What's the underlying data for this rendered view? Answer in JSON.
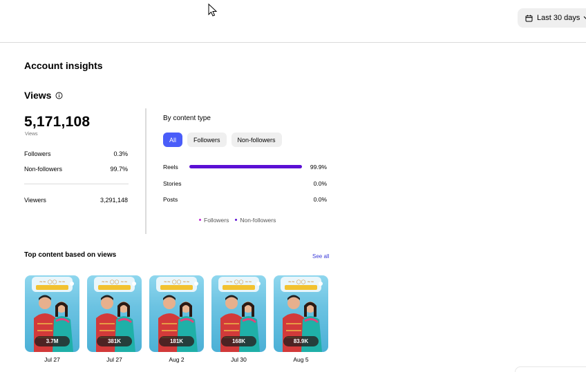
{
  "header": {
    "date_range_label": "Last 30 days",
    "calendar_icon": "calendar-icon",
    "chevron_icon": "chevron-down-icon"
  },
  "page_title": "Account insights",
  "views": {
    "title": "Views",
    "info_icon": "info-icon",
    "total": "5,171,108",
    "total_label": "Views",
    "followers_label": "Followers",
    "followers_pct": "0.3%",
    "nonfollowers_label": "Non-followers",
    "nonfollowers_pct": "99.7%",
    "viewers_label": "Viewers",
    "viewers_value": "3,291,148"
  },
  "content_type": {
    "title": "By content type",
    "tabs": [
      {
        "label": "All",
        "active": true
      },
      {
        "label": "Followers",
        "active": false
      },
      {
        "label": "Non-followers",
        "active": false
      }
    ],
    "rows": [
      {
        "label": "Reels",
        "pct": "99.9%",
        "value": 0.999
      },
      {
        "label": "Stories",
        "pct": "0.0%",
        "value": 0.0
      },
      {
        "label": "Posts",
        "pct": "0.0%",
        "value": 0.0
      }
    ],
    "legend": [
      {
        "label": "Followers",
        "color": "#c026d3"
      },
      {
        "label": "Non-followers",
        "color": "#5b0fd4"
      }
    ]
  },
  "top_content": {
    "title": "Top content based on views",
    "see_all": "See all",
    "items": [
      {
        "count": "3.7M",
        "date": "Jul 27"
      },
      {
        "count": "381K",
        "date": "Jul 27"
      },
      {
        "count": "181K",
        "date": "Aug 2"
      },
      {
        "count": "168K",
        "date": "Jul 30"
      },
      {
        "count": "83.9K",
        "date": "Aug 5"
      }
    ]
  },
  "colors": {
    "accent": "#4a5df9",
    "bar": "#5b0fd4",
    "link": "#3a3ad8"
  }
}
